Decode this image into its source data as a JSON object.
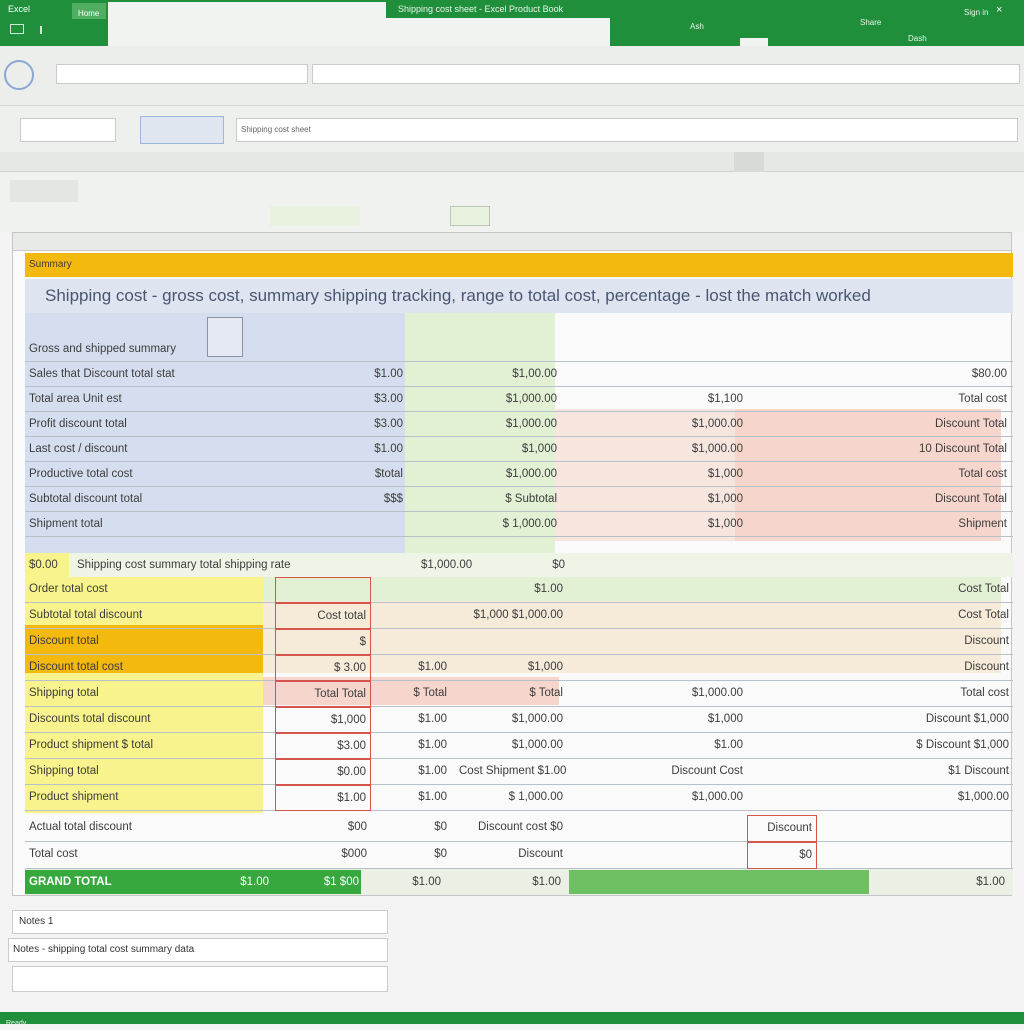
{
  "titlebar": {
    "app_label": "Excel",
    "tab_label": "Home",
    "doc_title": "Shipping cost sheet - Excel Product Book",
    "right_items": [
      "Ash",
      "Share",
      "Dash",
      "Sign in"
    ],
    "window_controls": [
      "minimize",
      "maximize",
      "close"
    ]
  },
  "ribbon": {
    "search_placeholder": "",
    "name_box": "",
    "formula": "Shipping cost sheet"
  },
  "sheet": {
    "section_label": "Summary",
    "header_text": "Shipping cost - gross cost, summary shipping tracking, range to total cost, percentage - lost the match worked",
    "rows_top": [
      {
        "label": "Gross and shipped summary",
        "v1": "",
        "v2": "",
        "v3": "",
        "v4": "",
        "v5": ""
      },
      {
        "label": "Sales that Discount total stat",
        "v1": "$1.00",
        "v2": "$1,00.00",
        "v3": "",
        "v4": "",
        "v5": "$80.00"
      },
      {
        "label": "Total area Unit est",
        "v1": "$3.00",
        "v2": "$1,000.00",
        "v3": "$1,100",
        "v4": "",
        "v5": "Total cost"
      },
      {
        "label": "Profit discount total",
        "v1": "$3.00",
        "v2": "$1,000.00",
        "v3": "$1,000.00",
        "v4": "",
        "v5": "Discount Total"
      },
      {
        "label": "Last cost / discount",
        "v1": "$1.00",
        "v2": "$1,000",
        "v3": "$1,000.00",
        "v4": "",
        "v5": "10 Discount Total"
      },
      {
        "label": "Productive total cost",
        "v1": "$total",
        "v2": "$1,000.00",
        "v3": "$1,000",
        "v4": "",
        "v5": "Total cost"
      },
      {
        "label": "Subtotal discount total",
        "v1": "$$$",
        "v2": "$ Subtotal",
        "v3": "$1,000",
        "v4": "",
        "v5": "Discount Total"
      },
      {
        "label": "Shipment total",
        "v1": "",
        "v2": "$ 1,000.00",
        "v3": "$1,000",
        "v4": "",
        "v5": "Shipment"
      }
    ],
    "mid_row": {
      "tag": "$0.00",
      "text": "Shipping cost summary total shipping rate",
      "value": "$1,000.00",
      "flag": "$0"
    },
    "yellow_rows": [
      {
        "label": "Order total cost",
        "v1": "",
        "v2": "",
        "v3": "$1.00",
        "v4": "",
        "v5": "Cost Total"
      },
      {
        "label": "Subtotal total discount",
        "v1": "Cost total",
        "v2": "",
        "v3": "$1,000 $1,000.00",
        "v4": "",
        "v5": "Cost Total"
      },
      {
        "label": "Discount total",
        "v1": "$",
        "v2": "",
        "v3": "",
        "v4": "",
        "v5": "Discount"
      },
      {
        "label": "Discount total cost",
        "v1": "$ 3.00",
        "v2": "$1.00",
        "v3": "$1,000",
        "v4": "",
        "v5": "Discount"
      },
      {
        "label": "Shipping total",
        "v1": "Total Total",
        "v2": "$ Total",
        "v3": "$ Total",
        "v4": "$1,000.00",
        "v5": "Total cost"
      },
      {
        "label": "Discounts total discount",
        "v1": "$1,000",
        "v2": "$1.00",
        "v3": "$1,000.00",
        "v4": "$1,000",
        "v5": "Discount $1,000"
      },
      {
        "label": "Product shipment $ total",
        "v1": "$3.00",
        "v2": "$1.00",
        "v3": "$1,000.00",
        "v4": "$1.00",
        "v5": "$ Discount $1,000"
      },
      {
        "label": "Shipping total",
        "v1": "$0.00",
        "v2": "$1.00",
        "v3": "Cost Shipment $1.00",
        "v4": "Discount Cost",
        "v5": "$1 Discount"
      },
      {
        "label": "Product shipment",
        "v1": "$1.00",
        "v2": "$1.00",
        "v3": "$ 1,000.00",
        "v4": "$1,000.00",
        "v5": "$1,000.00"
      }
    ],
    "lower_rows": [
      {
        "label": "Actual total discount",
        "v1": "$00",
        "v2": "$0",
        "v3": "Discount cost $0",
        "v4": "Discount",
        "v5": ""
      },
      {
        "label": "Total cost",
        "v1": "$000",
        "v2": "$0",
        "v3": "Discount",
        "v4": "$0",
        "v5": ""
      }
    ],
    "total_row": {
      "label": "GRAND TOTAL",
      "v1": "$1.00",
      "v2": "$1 $00",
      "v3": "$1.00",
      "v4": "$1.00",
      "v5": "$1.00"
    }
  },
  "footer": {
    "lines": [
      "Notes 1",
      "Notes - shipping total cost summary data",
      ""
    ],
    "status_text": "Ready"
  },
  "colors": {
    "accent_green": "#1f8f3c",
    "orange": "#f4b90e",
    "yellow": "#f8f38d",
    "blue_band": "#d4deee",
    "green_band": "#e2f0d3",
    "pink_band": "#f6d6cc"
  }
}
